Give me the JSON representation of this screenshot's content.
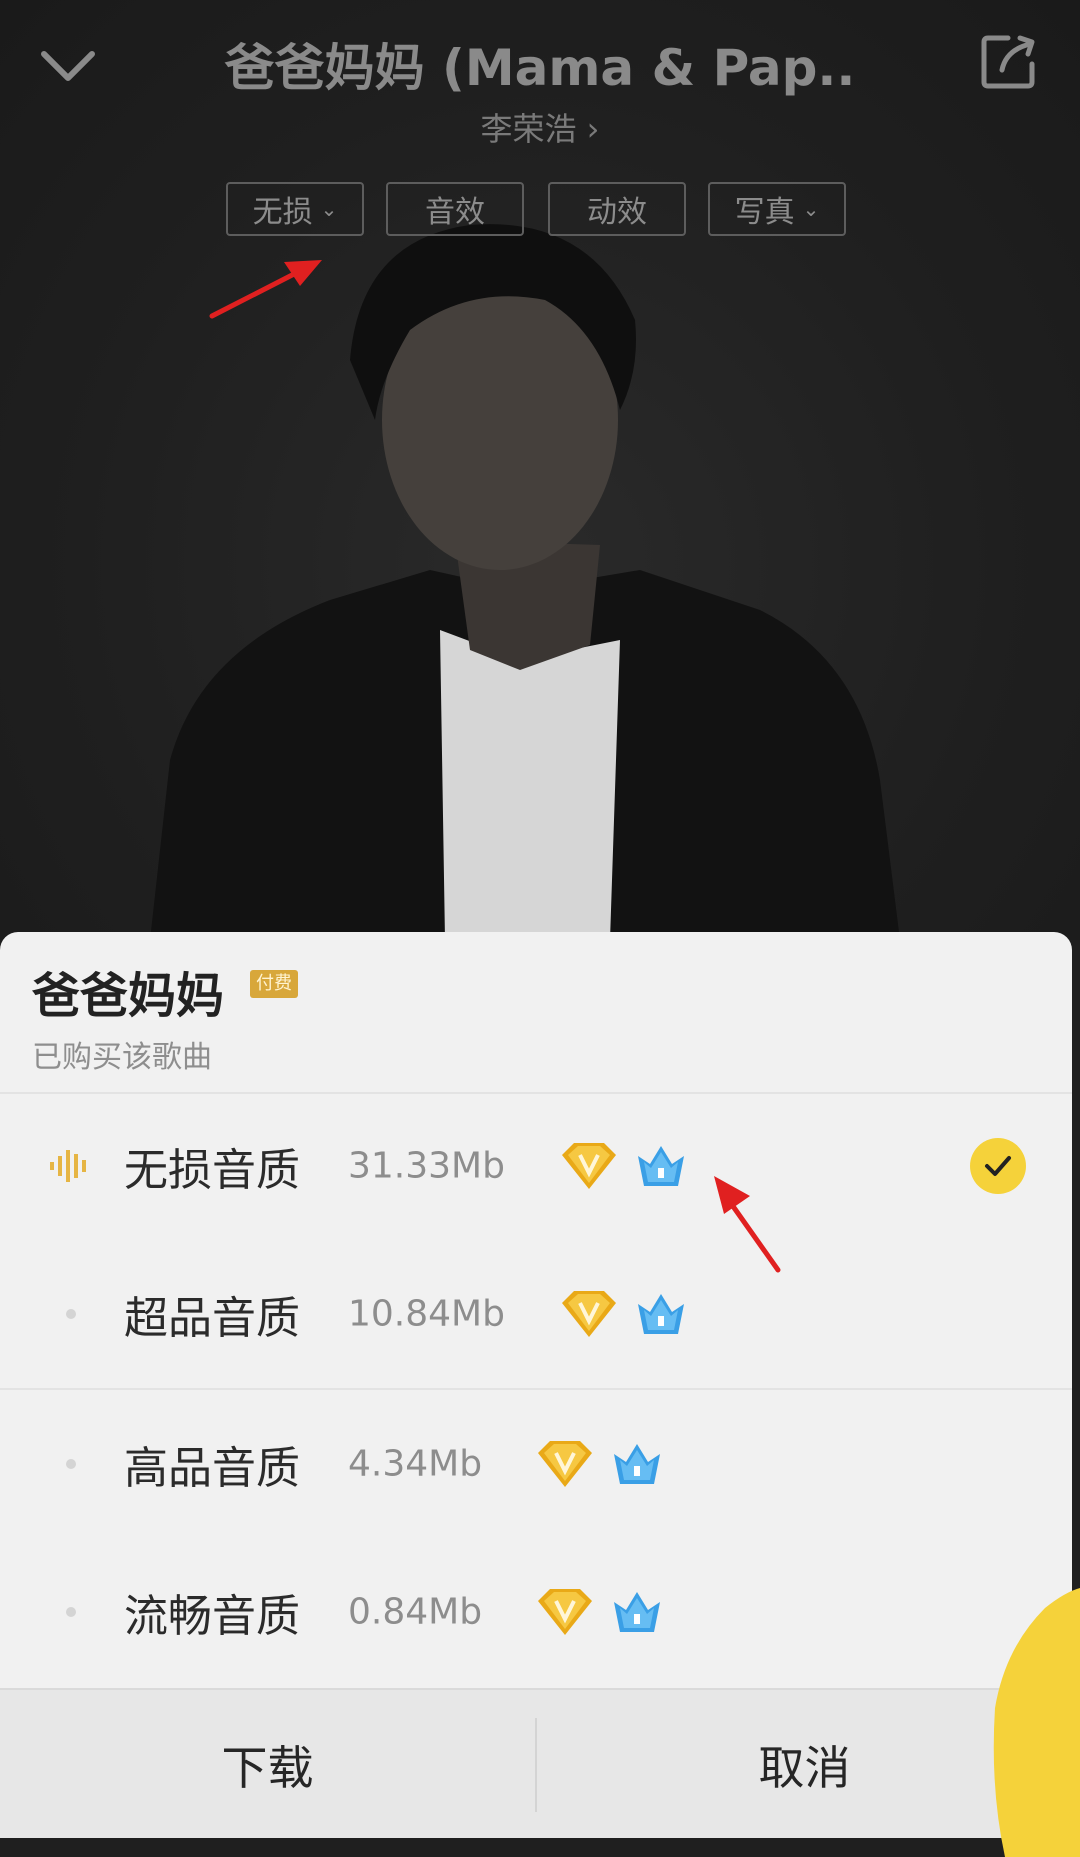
{
  "player": {
    "song_title": "爸爸妈妈 (Mama & Pap..",
    "artist": "李荣浩 ›",
    "chips": [
      {
        "label": "无损",
        "has_caret": true
      },
      {
        "label": "音效",
        "has_caret": false
      },
      {
        "label": "动效",
        "has_caret": false
      },
      {
        "label": "写真",
        "has_caret": true
      }
    ]
  },
  "sheet": {
    "title": "爸爸妈妈",
    "badge": "付费",
    "subtitle": "已购买该歌曲",
    "qualities": [
      {
        "label": "无损音质",
        "size": "31.33Mb",
        "selected": true
      },
      {
        "label": "超品音质",
        "size": "10.84Mb",
        "selected": false
      },
      {
        "label": "高品音质",
        "size": "4.34Mb",
        "selected": false
      },
      {
        "label": "流畅音质",
        "size": "0.84Mb",
        "selected": false
      }
    ],
    "footer": {
      "download": "下载",
      "cancel": "取消"
    }
  },
  "colors": {
    "accent_yellow": "#f5d23a",
    "vip_gold": "#e9a917",
    "vip_blue": "#3a9fe6",
    "annotation_red": "#e02020"
  }
}
